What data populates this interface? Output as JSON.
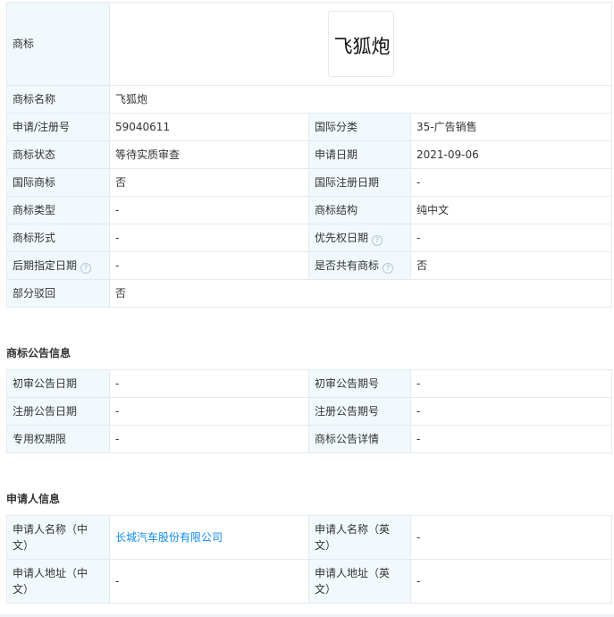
{
  "basic_info": {
    "logo_label": "商标",
    "logo_text": "飞狐炮",
    "rows": {
      "name": {
        "label": "商标名称",
        "value": "飞狐炮"
      },
      "reg_no": {
        "label": "申请/注册号",
        "value": "59040611"
      },
      "intl_class": {
        "label": "国际分类",
        "value": "35-广告销售"
      },
      "status": {
        "label": "商标状态",
        "value": "等待实质审查"
      },
      "apply_date": {
        "label": "申请日期",
        "value": "2021-09-06"
      },
      "intl_mark": {
        "label": "国际商标",
        "value": "否"
      },
      "intl_reg_date": {
        "label": "国际注册日期",
        "value": "-"
      },
      "mark_type": {
        "label": "商标类型",
        "value": "-"
      },
      "mark_structure": {
        "label": "商标结构",
        "value": "纯中文"
      },
      "mark_form": {
        "label": "商标形式",
        "value": "-"
      },
      "priority_date": {
        "label": "优先权日期",
        "value": "-"
      },
      "later_designation_date": {
        "label": "后期指定日期",
        "value": "-"
      },
      "shared": {
        "label": "是否共有商标",
        "value": "否"
      },
      "partial_reject": {
        "label": "部分驳回",
        "value": "否"
      }
    },
    "help_glyph": "?"
  },
  "announcement": {
    "title": "商标公告信息",
    "rows": {
      "prelim_date": {
        "label": "初审公告日期",
        "value": "-"
      },
      "prelim_no": {
        "label": "初审公告期号",
        "value": "-"
      },
      "reg_date": {
        "label": "注册公告日期",
        "value": "-"
      },
      "reg_no": {
        "label": "注册公告期号",
        "value": "-"
      },
      "exclusive_period": {
        "label": "专用权期限",
        "value": "-"
      },
      "details": {
        "label": "商标公告详情",
        "value": "-"
      }
    }
  },
  "applicant": {
    "title": "申请人信息",
    "rows": {
      "name_cn": {
        "label": "申请人名称（中文）",
        "value": "长城汽车股份有限公司"
      },
      "name_en": {
        "label": "申请人名称（英文）",
        "value": "-"
      },
      "addr_cn": {
        "label": "申请人地址（中文）",
        "value": "-"
      },
      "addr_en": {
        "label": "申请人地址（英文）",
        "value": "-"
      }
    }
  },
  "colors": {
    "label_bg": "#f2f9fc",
    "border": "#e4eaf2",
    "link": "#128bed",
    "text": "#333333"
  }
}
